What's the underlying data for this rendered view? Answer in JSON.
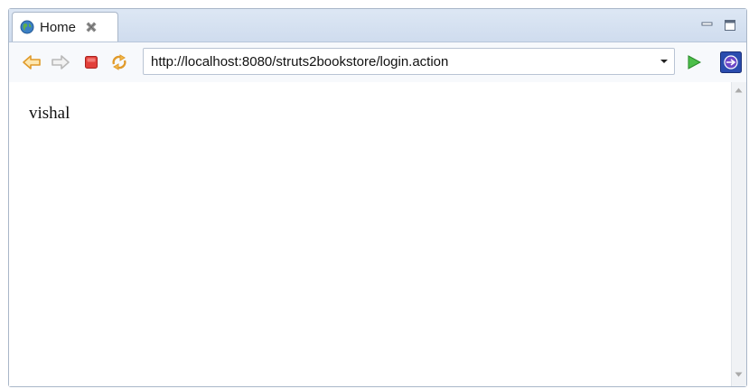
{
  "tab": {
    "title": "Home",
    "icon": "globe-icon"
  },
  "toolbar": {
    "back_icon": "back-arrow-icon",
    "forward_icon": "forward-arrow-icon",
    "stop_icon": "stop-icon",
    "refresh_icon": "refresh-icon",
    "go_icon": "go-play-icon",
    "extra_icon": "browser-app-icon"
  },
  "address_bar": {
    "url": "http://localhost:8080/struts2bookstore/login.action"
  },
  "page": {
    "body_text": "vishal"
  },
  "colors": {
    "accent_orange": "#e9a53a",
    "stop_red": "#d9302b",
    "go_green": "#3aa53a",
    "tab_bar": "#d6e1f0"
  }
}
